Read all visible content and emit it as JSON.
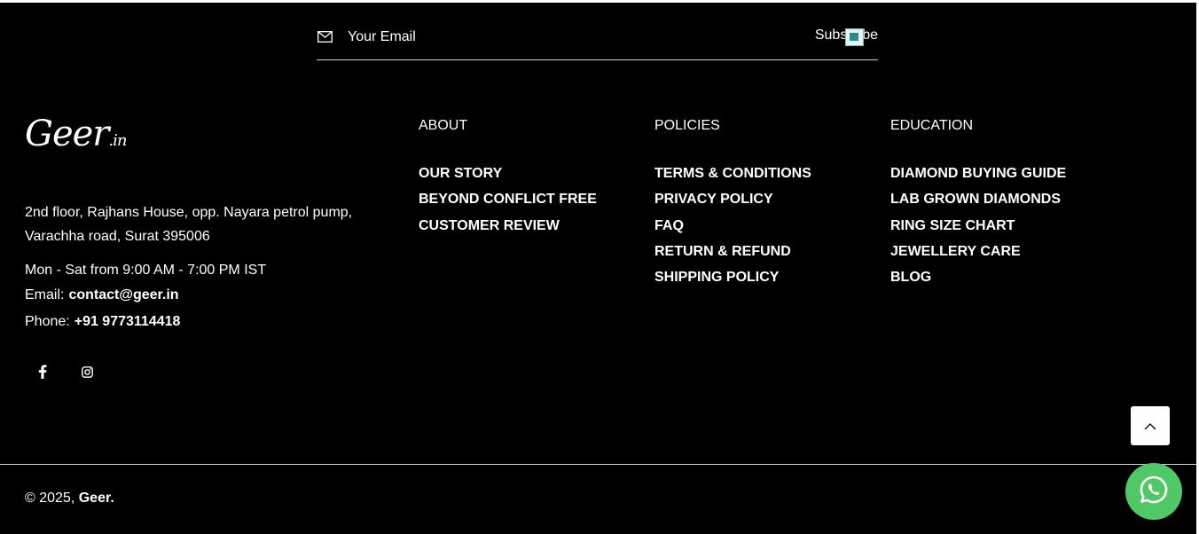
{
  "newsletter": {
    "email_placeholder": "Your Email",
    "subscribe_label": "Subscribe"
  },
  "brand": {
    "logo_text": "Geer",
    "logo_suffix": ".in"
  },
  "contact": {
    "address_line1": "2nd floor, Rajhans House, opp. Nayara petrol pump,",
    "address_line2": "Varachha road, Surat 395006",
    "hours": "Mon - Sat from 9:00 AM - 7:00 PM IST",
    "email_label": "Email:",
    "email_value": "contact@geer.in",
    "phone_label": "Phone:",
    "phone_value": "+91 9773114418"
  },
  "social": {
    "icons": [
      "facebook-icon",
      "instagram-icon"
    ]
  },
  "columns": {
    "about": {
      "title": "ABOUT",
      "items": [
        "OUR STORY",
        "BEYOND CONFLICT FREE",
        "CUSTOMER REVIEW"
      ]
    },
    "policies": {
      "title": "POLICIES",
      "items": [
        "TERMS & CONDITIONS",
        "PRIVACY POLICY",
        "FAQ",
        "RETURN & REFUND",
        "SHIPPING POLICY"
      ]
    },
    "education": {
      "title": "EDUCATION",
      "items": [
        "DIAMOND BUYING GUIDE",
        "LAB GROWN DIAMONDS",
        "RING SIZE CHART",
        "JEWELLERY CARE",
        "BLOG"
      ]
    }
  },
  "footer": {
    "copyright_prefix": "© 2025,",
    "copyright_brand": "Geer."
  },
  "colors": {
    "background": "#000000",
    "text": "#ffffff",
    "whatsapp": "#4fc865"
  }
}
